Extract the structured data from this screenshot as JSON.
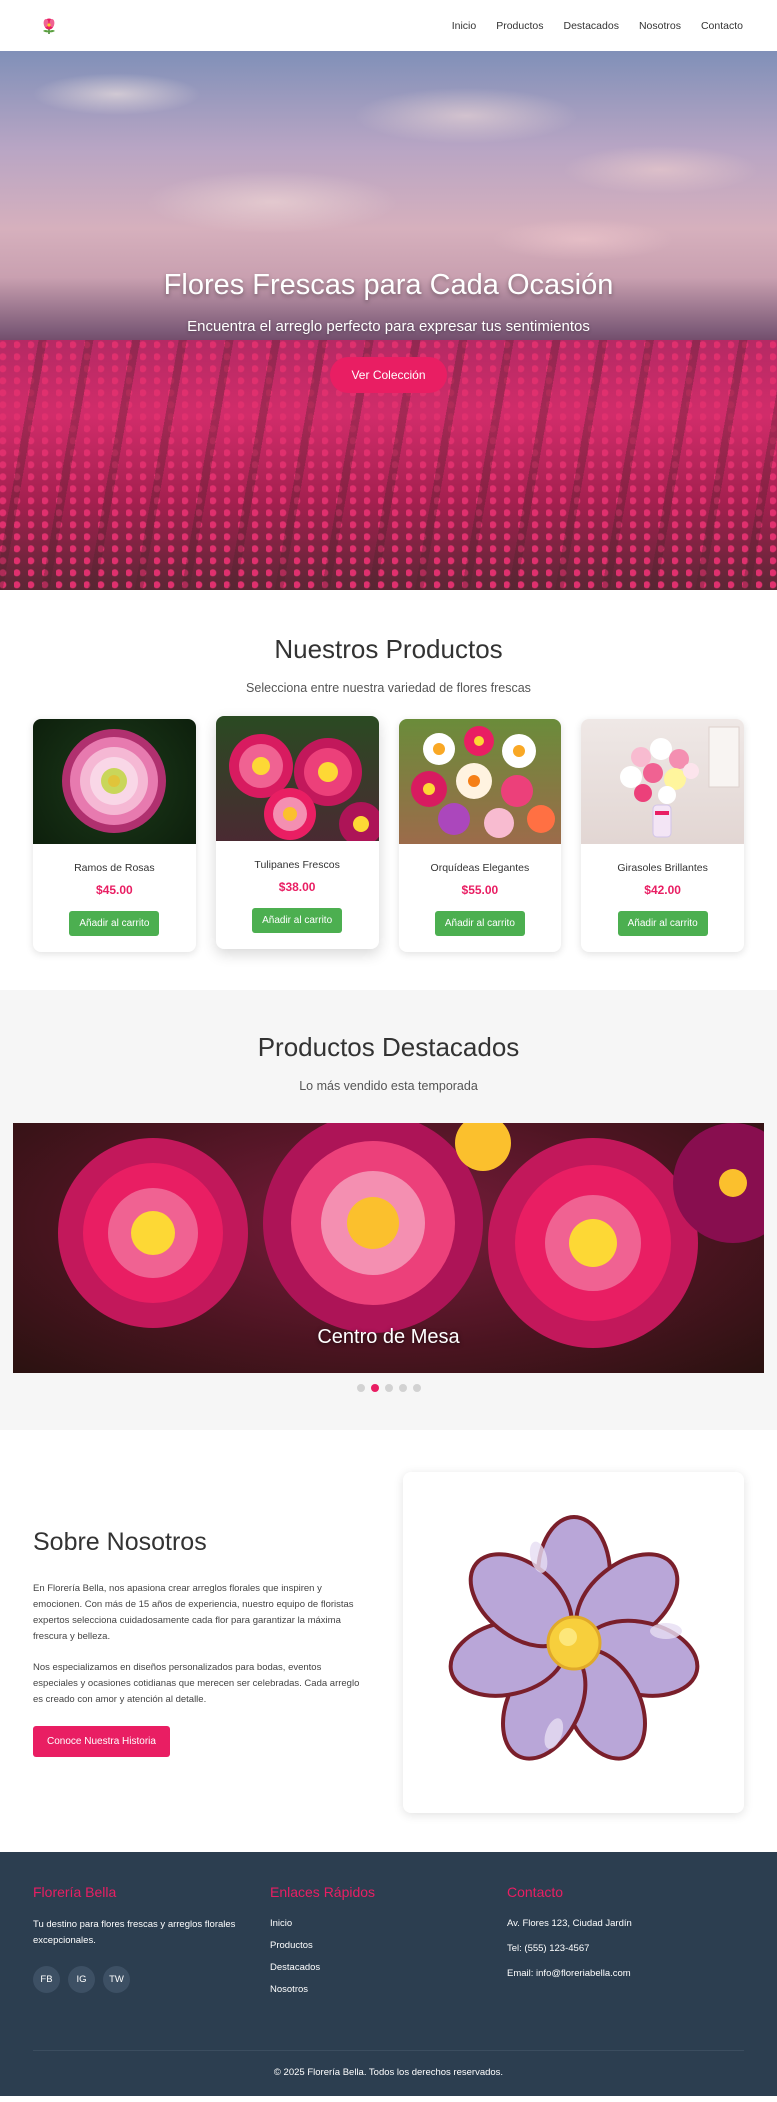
{
  "nav": {
    "items": [
      "Inicio",
      "Productos",
      "Destacados",
      "Nosotros",
      "Contacto"
    ]
  },
  "hero": {
    "title": "Flores Frescas para Cada Ocasión",
    "subtitle": "Encuentra el arreglo perfecto para expresar tus sentimientos",
    "cta": "Ver Colección"
  },
  "products": {
    "title": "Nuestros Productos",
    "subtitle": "Selecciona entre nuestra variedad de flores frescas",
    "button_label": "Añadir al carrito",
    "items": [
      {
        "name": "Ramos de Rosas",
        "price": "$45.00",
        "image": "pink-white-dahlia"
      },
      {
        "name": "Tulipanes Frescos",
        "price": "$38.00",
        "image": "pink-daisies"
      },
      {
        "name": "Orquídeas Elegantes",
        "price": "$55.00",
        "image": "mixed-bouquet"
      },
      {
        "name": "Girasoles Brillantes",
        "price": "$42.00",
        "image": "pastel-bouquet-vase"
      }
    ]
  },
  "featured": {
    "title": "Productos Destacados",
    "subtitle": "Lo más vendido esta temporada",
    "slide_caption": "Centro de Mesa",
    "slide_count": 5,
    "active_slide": 2
  },
  "about": {
    "title": "Sobre Nosotros",
    "p1": "En Florería Bella, nos apasiona crear arreglos florales que inspiren y emocionen. Con más de 15 años de experiencia, nuestro equipo de floristas expertos selecciona cuidadosamente cada flor para garantizar la máxima frescura y belleza.",
    "p2": "Nos especializamos en diseños personalizados para bodas, eventos especiales y ocasiones cotidianas que merecen ser celebradas. Cada arreglo es creado con amor y atención al detalle.",
    "cta": "Conoce Nuestra Historia",
    "image": "purple-flower-illustration"
  },
  "footer": {
    "brand_title": "Florería Bella",
    "brand_text": "Tu destino para flores frescas y arreglos florales excepcionales.",
    "social": [
      "FB",
      "IG",
      "TW"
    ],
    "links_title": "Enlaces Rápidos",
    "links": [
      "Inicio",
      "Productos",
      "Destacados",
      "Nosotros"
    ],
    "contact_title": "Contacto",
    "address": "Av. Flores 123, Ciudad Jardín",
    "phone": "Tel: (555) 123-4567",
    "email": "Email: info@floreriabella.com",
    "copyright": "© 2025 Florería Bella. Todos los derechos reservados."
  },
  "colors": {
    "accent": "#e91e63",
    "button_green": "#4caf50",
    "footer_bg": "#2c3e50"
  }
}
